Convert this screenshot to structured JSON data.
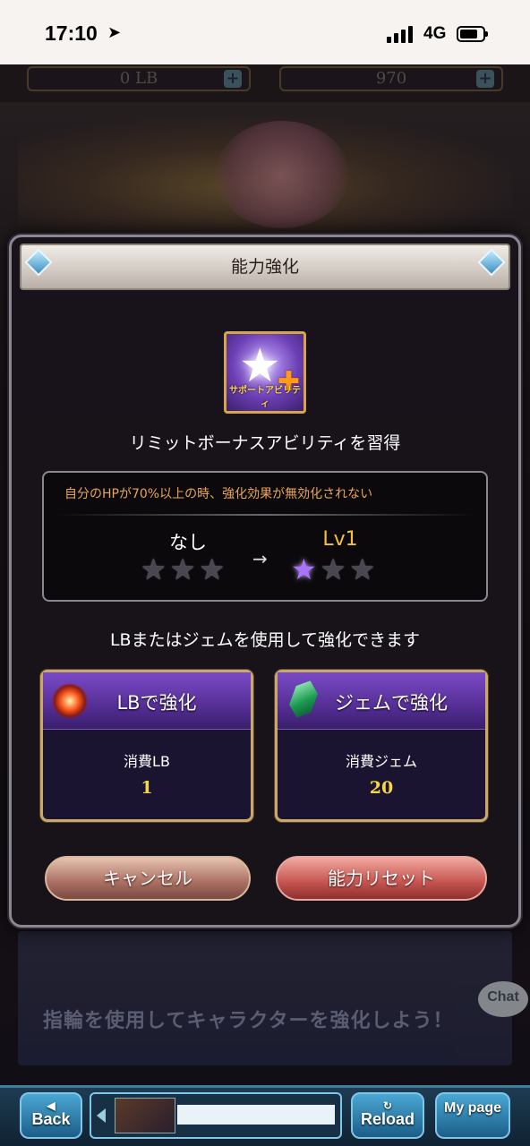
{
  "status_bar": {
    "time": "17:10",
    "network": "4G"
  },
  "background": {
    "lb_value": "0 LB",
    "gem_value": "970",
    "banner_text": "指輪を使用してキャラクターを強化しよう！",
    "chat_label": "Chat"
  },
  "modal": {
    "title": "能力強化",
    "ability_icon_caption": "サポートアビリティ",
    "learn_text": "リミットボーナスアビリティを習得",
    "description": "自分のHPが70%以上の時、強化効果が無効化されない",
    "current_level": "なし",
    "next_level": "Lv1",
    "current_stars_on": 0,
    "next_stars_on": 1,
    "arrow": "→",
    "use_text": "LBまたはジェムを使用して強化できます",
    "lb_option": {
      "label": "LBで強化",
      "cost_label": "消費LB",
      "cost_value": "1"
    },
    "gem_option": {
      "label": "ジェムで強化",
      "cost_label": "消費ジェム",
      "cost_value": "20"
    },
    "cancel_label": "キャンセル",
    "reset_label": "能力リセット"
  },
  "nav": {
    "back_label": "Back",
    "reload_label": "Reload",
    "mypage_label": "My page"
  }
}
